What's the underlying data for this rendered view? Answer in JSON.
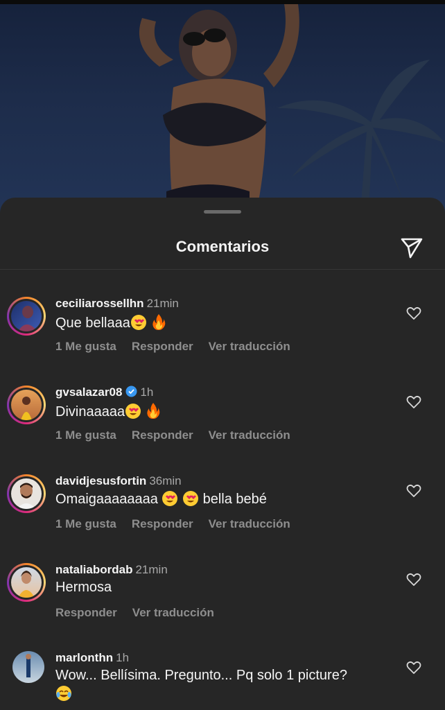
{
  "header": {
    "title": "Comentarios",
    "share_icon": "send-icon",
    "handle_icon": "drag-handle"
  },
  "comments": [
    {
      "username": "ceciliarossellhn",
      "time": "21min",
      "verified": false,
      "text": "Que bellaaa",
      "emojis": [
        "heart-eyes",
        "fire"
      ],
      "likes_label": "1 Me gusta",
      "reply_label": "Responder",
      "translate_label": "Ver traducción"
    },
    {
      "username": "gvsalazar08",
      "time": "1h",
      "verified": true,
      "text": "Divinaaaaa",
      "emojis": [
        "heart-eyes",
        "fire"
      ],
      "likes_label": "1 Me gusta",
      "reply_label": "Responder",
      "translate_label": "Ver traducción"
    },
    {
      "username": "davidjesusfortin",
      "time": "36min",
      "verified": false,
      "text_before": "Omaigaaaaaaaa",
      "text_after": "bella bebé",
      "emojis": [
        "heart-eyes",
        "heart-eyes"
      ],
      "likes_label": "1 Me gusta",
      "reply_label": "Responder",
      "translate_label": "Ver traducción"
    },
    {
      "username": "nataliabordab",
      "time": "21min",
      "verified": false,
      "text": "Hermosa",
      "reply_label": "Responder",
      "translate_label": "Ver traducción"
    },
    {
      "username": "marlonthn",
      "time": "1h",
      "verified": false,
      "text": "Wow... Bellísima. Pregunto... Pq solo 1 picture?",
      "emojis": [
        "tears-of-joy"
      ]
    }
  ],
  "colors": {
    "background": "#262626",
    "muted": "#8e8e8e",
    "verified": "#3897f0",
    "ring": "#dd2a7b"
  }
}
